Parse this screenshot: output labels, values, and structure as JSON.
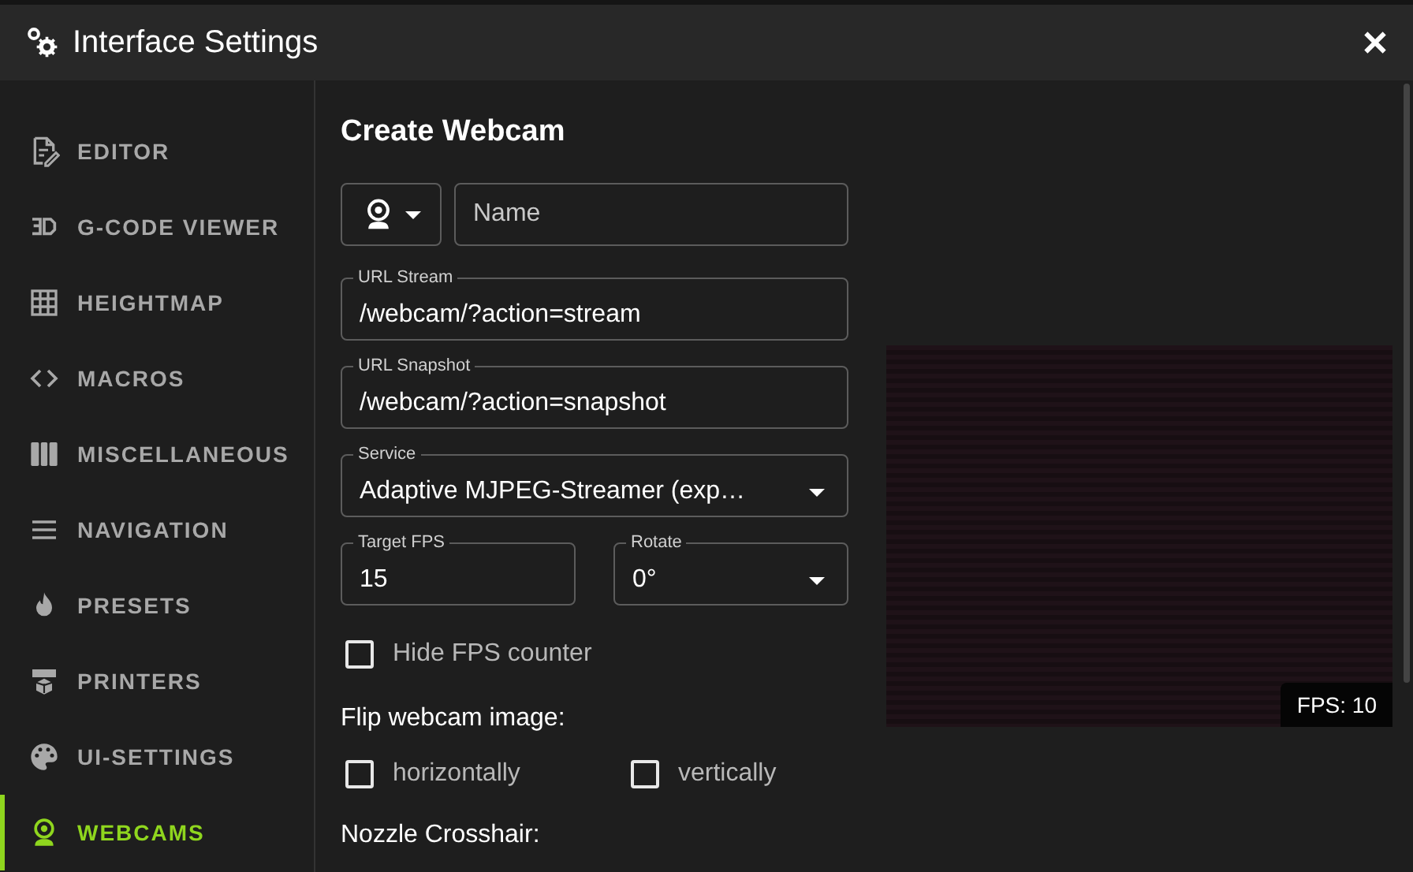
{
  "window": {
    "title": "Interface Settings"
  },
  "sidebar": {
    "items": [
      {
        "label": "EDITOR",
        "selected": false
      },
      {
        "label": "G-CODE VIEWER",
        "selected": false
      },
      {
        "label": "HEIGHTMAP",
        "selected": false
      },
      {
        "label": "MACROS",
        "selected": false
      },
      {
        "label": "MISCELLANEOUS",
        "selected": false
      },
      {
        "label": "NAVIGATION",
        "selected": false
      },
      {
        "label": "PRESETS",
        "selected": false
      },
      {
        "label": "PRINTERS",
        "selected": false
      },
      {
        "label": "UI-SETTINGS",
        "selected": false
      },
      {
        "label": "WEBCAMS",
        "selected": true
      }
    ]
  },
  "form": {
    "title": "Create Webcam",
    "name_field": {
      "placeholder": "Name"
    },
    "url_stream": {
      "label": "URL Stream",
      "value": "/webcam/?action=stream"
    },
    "url_snapshot": {
      "label": "URL Snapshot",
      "value": "/webcam/?action=snapshot"
    },
    "service": {
      "label": "Service",
      "value": "Adaptive MJPEG-Streamer (exp…"
    },
    "target_fps": {
      "label": "Target FPS",
      "value": "15"
    },
    "rotate": {
      "label": "Rotate",
      "value": "0°"
    },
    "hide_fps": {
      "label": "Hide FPS counter",
      "checked": false
    },
    "flip_heading": "Flip webcam image:",
    "flip_options": [
      {
        "label": "horizontally",
        "checked": false
      },
      {
        "label": "vertically",
        "checked": false
      }
    ],
    "crosshair_heading": "Nozzle Crosshair:"
  },
  "preview": {
    "fps": "FPS: 10"
  }
}
